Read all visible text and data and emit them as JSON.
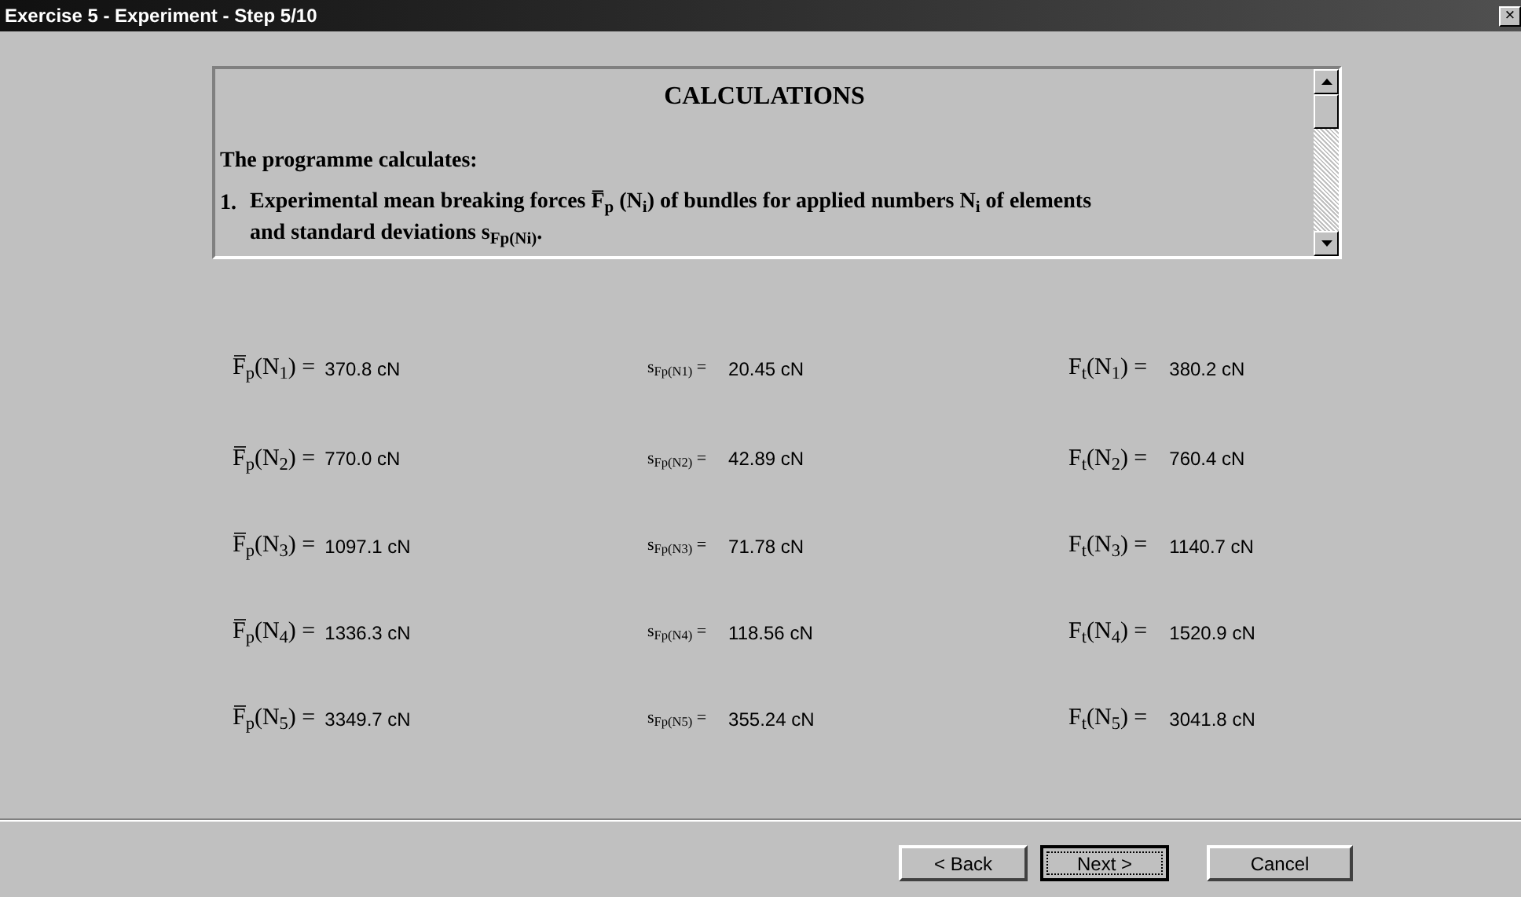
{
  "window": {
    "title": "Exercise 5 - Experiment - Step 5/10",
    "close": "×"
  },
  "info": {
    "heading": "CALCULATIONS",
    "intro": "The programme calculates:",
    "items": [
      {
        "number": "1.",
        "text": "Experimental mean breaking forces F̅$_{p}$ (N$_{i}$) of bundles for applied numbers N$_{i}$ of elements and standard deviations s$_{Fp(Ni)}$."
      }
    ]
  },
  "columns": [
    {
      "kind": "mean",
      "cells": [
        {
          "label": "F̅$_{p}$(N$_{1}$) =",
          "value": "370.8 cN"
        },
        {
          "label": "F̅$_{p}$(N$_{2}$) =",
          "value": "770.0 cN"
        },
        {
          "label": "F̅$_{p}$(N$_{3}$) =",
          "value": "1097.1 cN"
        },
        {
          "label": "F̅$_{p}$(N$_{4}$) =",
          "value": "1336.3 cN"
        },
        {
          "label": "F̅$_{p}$(N$_{5}$) =",
          "value": "3349.7 cN"
        }
      ]
    },
    {
      "kind": "deviation",
      "cells": [
        {
          "label": "s$_{Fp(N1)}$ =",
          "value": "20.45 cN"
        },
        {
          "label": "s$_{Fp(N2)}$ =",
          "value": "42.89 cN"
        },
        {
          "label": "s$_{Fp(N3)}$ =",
          "value": "71.78 cN"
        },
        {
          "label": "s$_{Fp(N4)}$ =",
          "value": "118.56 cN"
        },
        {
          "label": "s$_{Fp(N5)}$ =",
          "value": "355.24 cN"
        }
      ]
    },
    {
      "kind": "theoretical",
      "cells": [
        {
          "label": "F$_{t}$(N$_{1}$) =",
          "value": "380.2 cN"
        },
        {
          "label": "F$_{t}$(N$_{2}$) =",
          "value": "760.4 cN"
        },
        {
          "label": "F$_{t}$(N$_{3}$) =",
          "value": "1140.7 cN"
        },
        {
          "label": "F$_{t}$(N$_{4}$) =",
          "value": "1520.9 cN"
        },
        {
          "label": "F$_{t}$(N$_{5}$) =",
          "value": "3041.8 cN"
        }
      ]
    }
  ],
  "buttons": [
    {
      "label": "< Back",
      "default": false
    },
    {
      "label": "Next >",
      "default": true
    },
    {
      "label": "Cancel",
      "default": false
    }
  ]
}
